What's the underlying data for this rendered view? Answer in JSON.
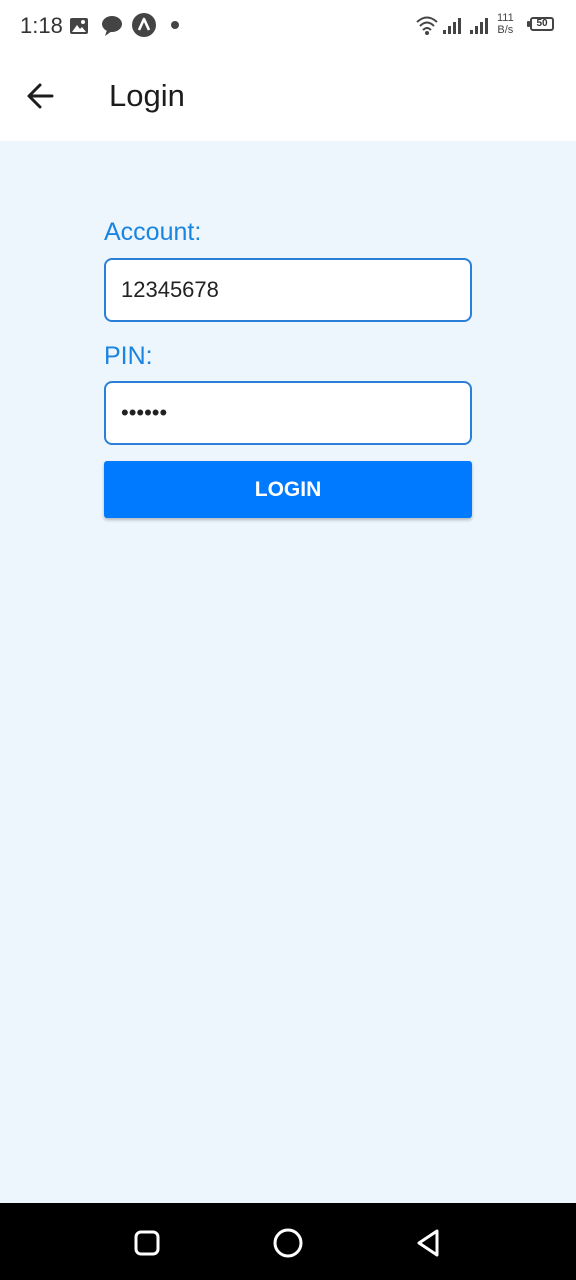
{
  "status_bar": {
    "time": "1:18",
    "net_speed_value": "111",
    "net_speed_unit": "B/s",
    "battery": "50",
    "icons": [
      "image-icon",
      "chat-bubble-icon",
      "app-a-icon",
      "notification-dot-icon",
      "wifi-icon",
      "signal-icon",
      "signal-icon-2",
      "battery-icon"
    ]
  },
  "appbar": {
    "title": "Login",
    "back_icon": "arrow-left-icon"
  },
  "form": {
    "account_label": "Account:",
    "account_value": "12345678",
    "pin_label": "PIN:",
    "pin_value": "••••••",
    "login_label": "LOGIN"
  },
  "nav_bar": {
    "icons": [
      "recents-square-icon",
      "home-circle-icon",
      "back-triangle-icon"
    ]
  },
  "colors": {
    "accent": "#007aff",
    "label": "#1a85e0",
    "background": "#edf5fd",
    "input_border": "#2a7fd6"
  }
}
